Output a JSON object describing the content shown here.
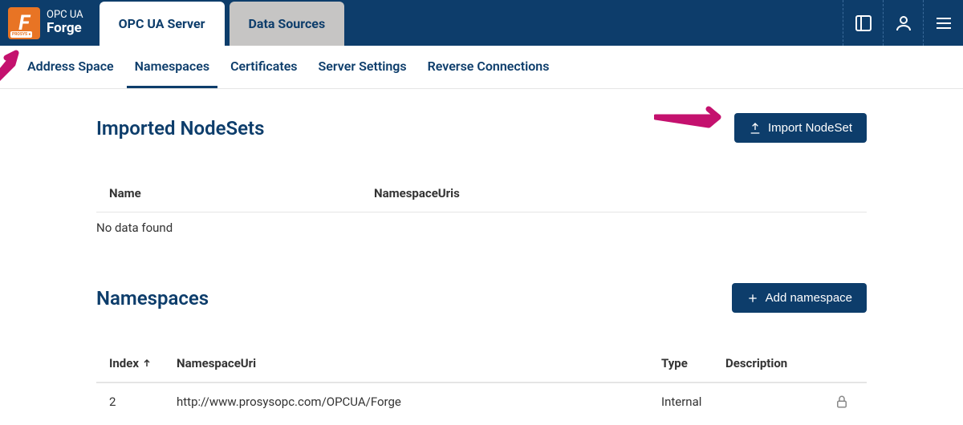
{
  "app": {
    "logo_line1": "OPC UA",
    "logo_line2": "Forge",
    "logo_letter": "F"
  },
  "main_tabs": [
    {
      "label": "OPC UA Server",
      "active": true
    },
    {
      "label": "Data Sources",
      "active": false
    }
  ],
  "sub_tabs": [
    {
      "label": "Address Space",
      "active": false
    },
    {
      "label": "Namespaces",
      "active": true
    },
    {
      "label": "Certificates",
      "active": false
    },
    {
      "label": "Server Settings",
      "active": false
    },
    {
      "label": "Reverse Connections",
      "active": false
    }
  ],
  "imported_nodesets": {
    "title": "Imported NodeSets",
    "import_button": "Import NodeSet",
    "col_name": "Name",
    "col_nsuris": "NamespaceUris",
    "no_data": "No data found"
  },
  "namespaces": {
    "title": "Namespaces",
    "add_button": "Add namespace",
    "col_index": "Index",
    "col_nsuri": "NamespaceUri",
    "col_type": "Type",
    "col_desc": "Description",
    "rows": [
      {
        "index": "2",
        "nsuri": "http://www.prosysopc.com/OPCUA/Forge",
        "type": "Internal",
        "desc": ""
      }
    ]
  }
}
